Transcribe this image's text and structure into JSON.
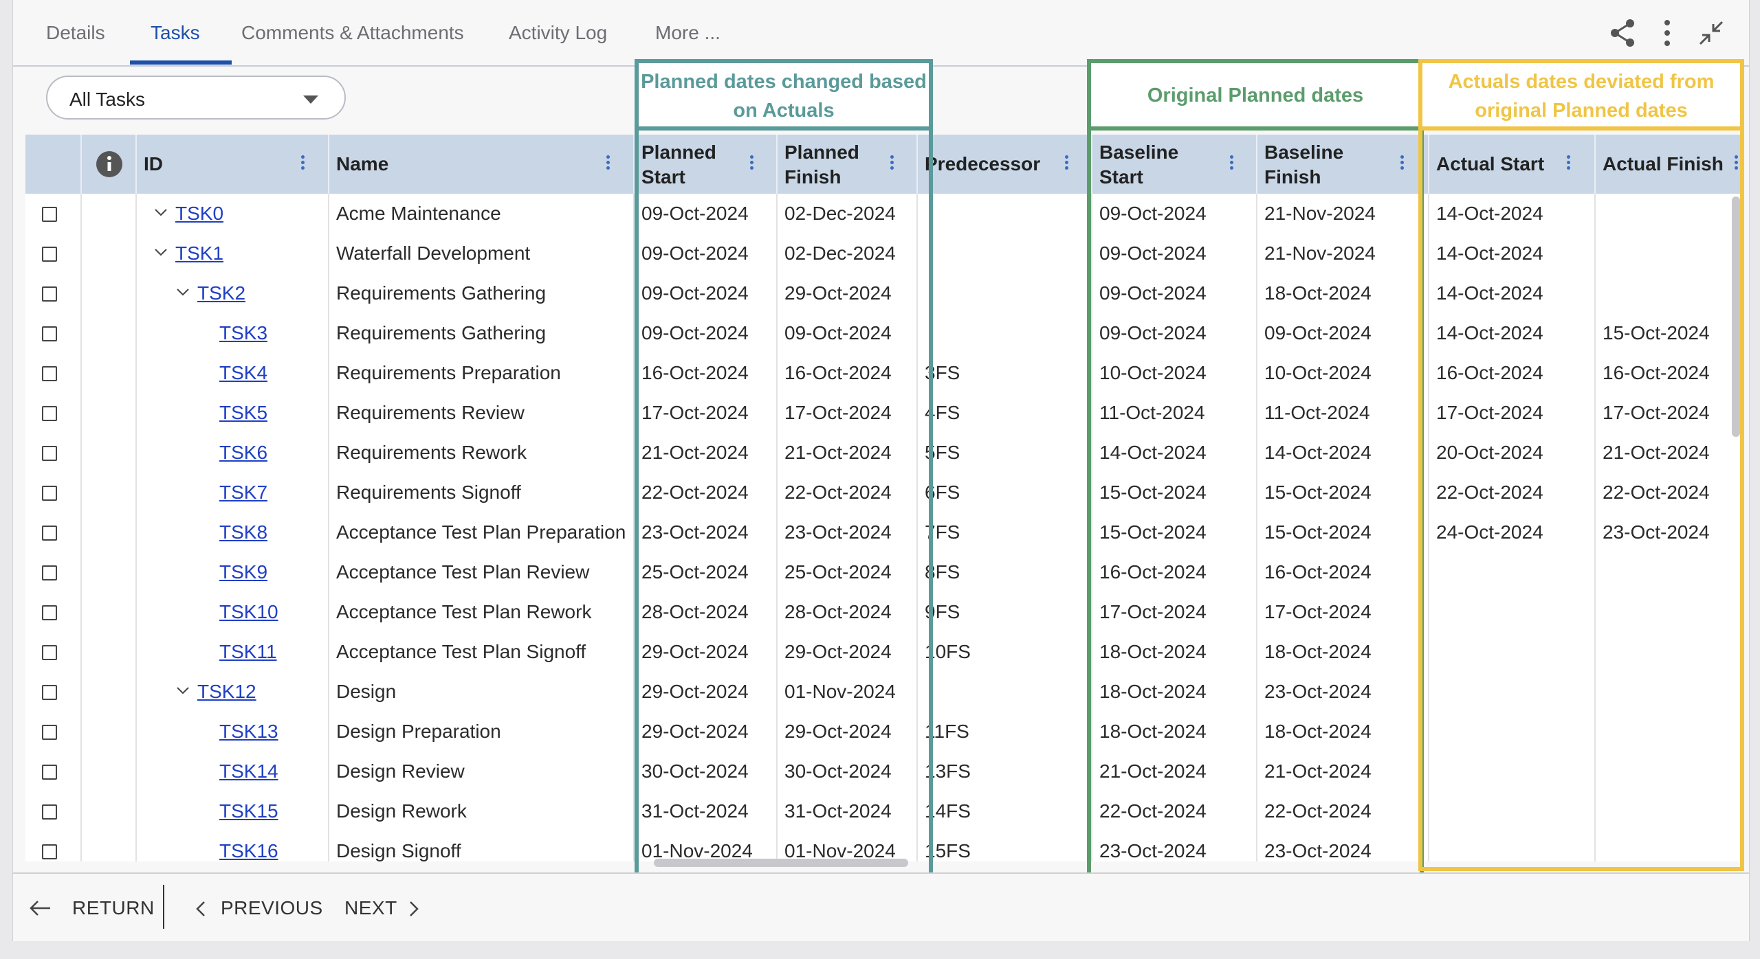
{
  "tabs": [
    {
      "label": "Details"
    },
    {
      "label": "Tasks"
    },
    {
      "label": "Comments & Attachments"
    },
    {
      "label": "Activity Log"
    },
    {
      "label": "More ..."
    }
  ],
  "active_tab": "Tasks",
  "filter": {
    "selected": "All Tasks"
  },
  "columns": {
    "id": "ID",
    "name": "Name",
    "planned_start": "Planned Start",
    "planned_finish": "Planned Finish",
    "predecessor": "Predecessor",
    "baseline_start": "Baseline Start",
    "baseline_finish": "Baseline Finish",
    "actual_start": "Actual Start",
    "actual_finish": "Actual Finish"
  },
  "annotations": {
    "planned": "Planned dates changed based on Actuals",
    "original": "Original Planned dates",
    "actuals": "Actuals dates deviated from original Planned dates"
  },
  "annotation_colors": {
    "planned": "#5a9a9a",
    "original": "#5c9c6c",
    "actuals": "#f0c545"
  },
  "rows": [
    {
      "id": "TSK0",
      "name": "Acme Maintenance",
      "ps": "09-Oct-2024",
      "pf": "02-Dec-2024",
      "pred": "",
      "bs": "09-Oct-2024",
      "bf": "21-Nov-2024",
      "as": "14-Oct-2024",
      "af": ""
    },
    {
      "id": "TSK1",
      "name": "Waterfall Development",
      "ps": "09-Oct-2024",
      "pf": "02-Dec-2024",
      "pred": "",
      "bs": "09-Oct-2024",
      "bf": "21-Nov-2024",
      "as": "14-Oct-2024",
      "af": ""
    },
    {
      "id": "TSK2",
      "name": "Requirements Gathering",
      "ps": "09-Oct-2024",
      "pf": "29-Oct-2024",
      "pred": "",
      "bs": "09-Oct-2024",
      "bf": "18-Oct-2024",
      "as": "14-Oct-2024",
      "af": ""
    },
    {
      "id": "TSK3",
      "name": "Requirements Gathering",
      "ps": "09-Oct-2024",
      "pf": "09-Oct-2024",
      "pred": "",
      "bs": "09-Oct-2024",
      "bf": "09-Oct-2024",
      "as": "14-Oct-2024",
      "af": "15-Oct-2024"
    },
    {
      "id": "TSK4",
      "name": "Requirements Preparation",
      "ps": "16-Oct-2024",
      "pf": "16-Oct-2024",
      "pred": "3FS",
      "bs": "10-Oct-2024",
      "bf": "10-Oct-2024",
      "as": "16-Oct-2024",
      "af": "16-Oct-2024"
    },
    {
      "id": "TSK5",
      "name": "Requirements Review",
      "ps": "17-Oct-2024",
      "pf": "17-Oct-2024",
      "pred": "4FS",
      "bs": "11-Oct-2024",
      "bf": "11-Oct-2024",
      "as": "17-Oct-2024",
      "af": "17-Oct-2024"
    },
    {
      "id": "TSK6",
      "name": "Requirements Rework",
      "ps": "21-Oct-2024",
      "pf": "21-Oct-2024",
      "pred": "5FS",
      "bs": "14-Oct-2024",
      "bf": "14-Oct-2024",
      "as": "20-Oct-2024",
      "af": "21-Oct-2024"
    },
    {
      "id": "TSK7",
      "name": "Requirements Signoff",
      "ps": "22-Oct-2024",
      "pf": "22-Oct-2024",
      "pred": "6FS",
      "bs": "15-Oct-2024",
      "bf": "15-Oct-2024",
      "as": "22-Oct-2024",
      "af": "22-Oct-2024"
    },
    {
      "id": "TSK8",
      "name": "Acceptance Test Plan Preparation",
      "ps": "23-Oct-2024",
      "pf": "23-Oct-2024",
      "pred": "7FS",
      "bs": "15-Oct-2024",
      "bf": "15-Oct-2024",
      "as": "24-Oct-2024",
      "af": "23-Oct-2024"
    },
    {
      "id": "TSK9",
      "name": "Acceptance Test Plan Review",
      "ps": "25-Oct-2024",
      "pf": "25-Oct-2024",
      "pred": "8FS",
      "bs": "16-Oct-2024",
      "bf": "16-Oct-2024",
      "as": "",
      "af": ""
    },
    {
      "id": "TSK10",
      "name": "Acceptance Test Plan Rework",
      "ps": "28-Oct-2024",
      "pf": "28-Oct-2024",
      "pred": "9FS",
      "bs": "17-Oct-2024",
      "bf": "17-Oct-2024",
      "as": "",
      "af": ""
    },
    {
      "id": "TSK11",
      "name": "Acceptance Test Plan Signoff",
      "ps": "29-Oct-2024",
      "pf": "29-Oct-2024",
      "pred": "10FS",
      "bs": "18-Oct-2024",
      "bf": "18-Oct-2024",
      "as": "",
      "af": ""
    },
    {
      "id": "TSK12",
      "name": "Design",
      "ps": "29-Oct-2024",
      "pf": "01-Nov-2024",
      "pred": "",
      "bs": "18-Oct-2024",
      "bf": "23-Oct-2024",
      "as": "",
      "af": ""
    },
    {
      "id": "TSK13",
      "name": "Design Preparation",
      "ps": "29-Oct-2024",
      "pf": "29-Oct-2024",
      "pred": "11FS",
      "bs": "18-Oct-2024",
      "bf": "18-Oct-2024",
      "as": "",
      "af": ""
    },
    {
      "id": "TSK14",
      "name": "Design Review",
      "ps": "30-Oct-2024",
      "pf": "30-Oct-2024",
      "pred": "13FS",
      "bs": "21-Oct-2024",
      "bf": "21-Oct-2024",
      "as": "",
      "af": ""
    },
    {
      "id": "TSK15",
      "name": "Design Rework",
      "ps": "31-Oct-2024",
      "pf": "31-Oct-2024",
      "pred": "14FS",
      "bs": "22-Oct-2024",
      "bf": "22-Oct-2024",
      "as": "",
      "af": ""
    },
    {
      "id": "TSK16",
      "name": "Design Signoff",
      "ps": "01-Nov-2024",
      "pf": "01-Nov-2024",
      "pred": "15FS",
      "bs": "23-Oct-2024",
      "bf": "23-Oct-2024",
      "as": "",
      "af": ""
    }
  ],
  "footer": {
    "return": "RETURN",
    "previous": "PREVIOUS",
    "next": "NEXT"
  }
}
